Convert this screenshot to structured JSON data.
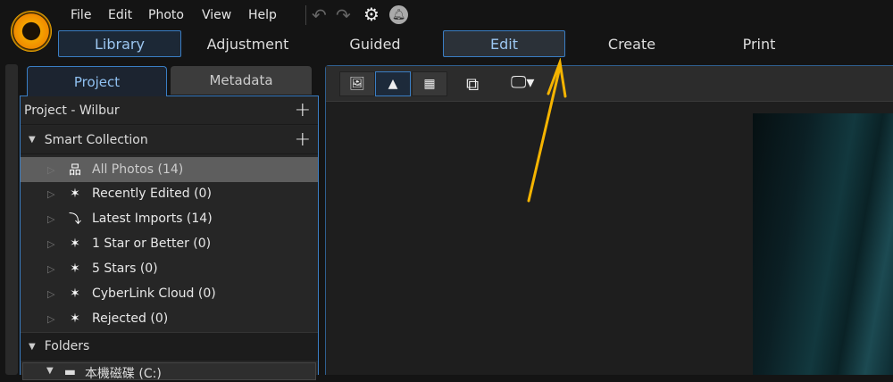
{
  "menu": [
    "File",
    "Edit",
    "Photo",
    "View",
    "Help"
  ],
  "modes": [
    "Library",
    "Adjustment",
    "Guided",
    "Edit",
    "Create",
    "Print"
  ],
  "panel_tabs": [
    "Project",
    "Metadata"
  ],
  "project_title": "Project - Wilbur",
  "smart_collection": "Smart Collection",
  "items": [
    {
      "label": "All Photos (14)",
      "icon": "hierarchy-icon"
    },
    {
      "label": "Recently Edited (0)",
      "icon": "magic-wand-icon"
    },
    {
      "label": "Latest Imports (14)",
      "icon": "import-icon"
    },
    {
      "label": "1 Star or Better (0)",
      "icon": "magic-wand-icon"
    },
    {
      "label": "5 Stars (0)",
      "icon": "magic-wand-icon"
    },
    {
      "label": "CyberLink Cloud (0)",
      "icon": "magic-wand-icon"
    },
    {
      "label": "Rejected (0)",
      "icon": "magic-wand-icon"
    }
  ],
  "folders": "Folders",
  "drive": "本機磁碟 (C:)",
  "colors": {
    "accent": "#3a7ec4",
    "arrow": "#f5b400"
  }
}
